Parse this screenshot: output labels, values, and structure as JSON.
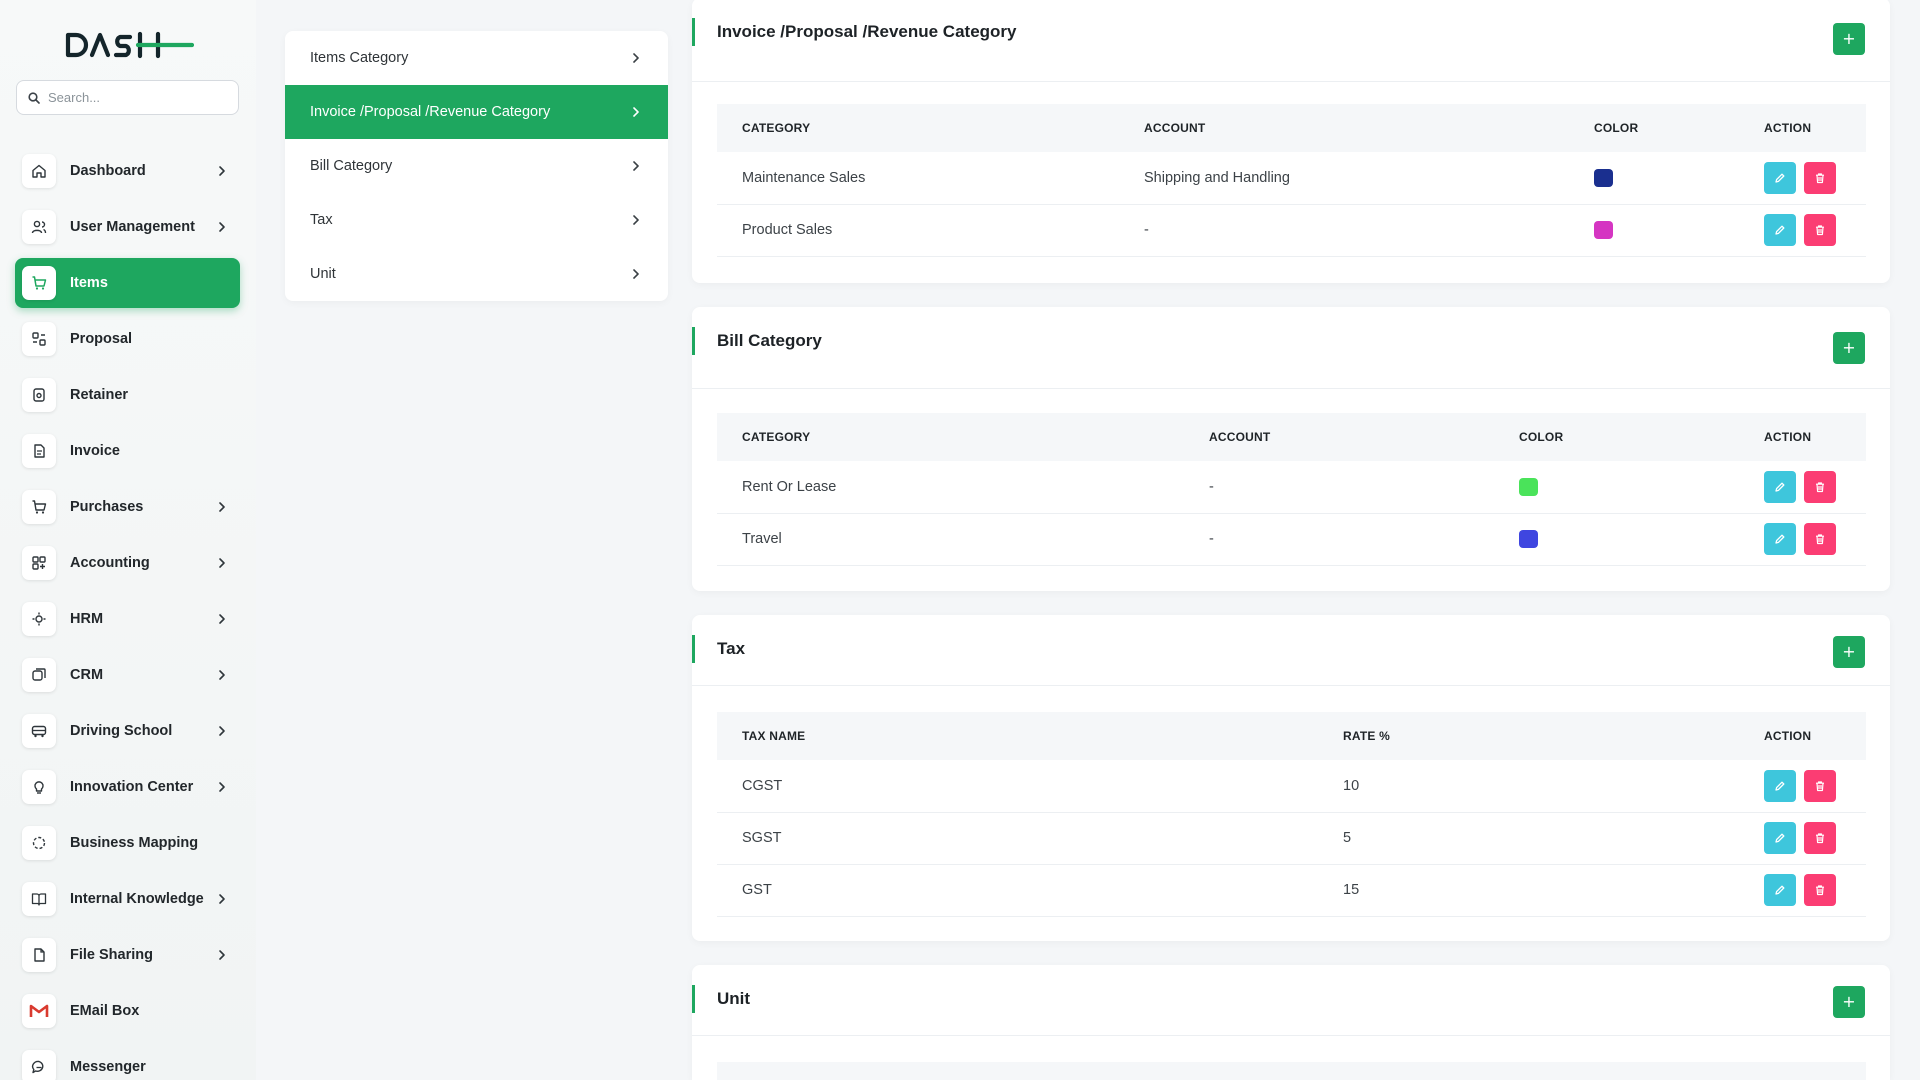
{
  "app": {
    "logo_text": "DASH"
  },
  "search": {
    "placeholder": "Search..."
  },
  "sidebar": {
    "items": [
      {
        "label": "Dashboard",
        "icon": "home-icon",
        "chevron": true,
        "active": false
      },
      {
        "label": "User Management",
        "icon": "users-icon",
        "chevron": true,
        "active": false
      },
      {
        "label": "Items",
        "icon": "cart-icon",
        "chevron": false,
        "active": true
      },
      {
        "label": "Proposal",
        "icon": "proposal-icon",
        "chevron": false,
        "active": false
      },
      {
        "label": "Retainer",
        "icon": "retainer-icon",
        "chevron": false,
        "active": false
      },
      {
        "label": "Invoice",
        "icon": "invoice-icon",
        "chevron": false,
        "active": false
      },
      {
        "label": "Purchases",
        "icon": "cart-icon",
        "chevron": true,
        "active": false
      },
      {
        "label": "Accounting",
        "icon": "grid-icon",
        "chevron": true,
        "active": false
      },
      {
        "label": "HRM",
        "icon": "hrm-icon",
        "chevron": true,
        "active": false
      },
      {
        "label": "CRM",
        "icon": "crm-icon",
        "chevron": true,
        "active": false
      },
      {
        "label": "Driving School",
        "icon": "bus-icon",
        "chevron": true,
        "active": false
      },
      {
        "label": "Innovation Center",
        "icon": "bulb-icon",
        "chevron": true,
        "active": false
      },
      {
        "label": "Business Mapping",
        "icon": "circle-dashed-icon",
        "chevron": false,
        "active": false
      },
      {
        "label": "Internal Knowledge",
        "icon": "book-icon",
        "chevron": true,
        "active": false
      },
      {
        "label": "File Sharing",
        "icon": "file-icon",
        "chevron": true,
        "active": false
      },
      {
        "label": "EMail Box",
        "icon": "gmail-icon",
        "chevron": false,
        "active": false
      },
      {
        "label": "Messenger",
        "icon": "chat-icon",
        "chevron": false,
        "active": false
      }
    ]
  },
  "settings_menu": {
    "items": [
      {
        "label": "Items Category",
        "active": false
      },
      {
        "label": "Invoice /Proposal /Revenue Category",
        "active": true
      },
      {
        "label": "Bill Category",
        "active": false
      },
      {
        "label": "Tax",
        "active": false
      },
      {
        "label": "Unit",
        "active": false
      }
    ]
  },
  "invoice_category": {
    "title": "Invoice /Proposal /Revenue Category",
    "add_label": "+",
    "columns": [
      "CATEGORY",
      "ACCOUNT",
      "COLOR",
      "ACTION"
    ],
    "rows": [
      {
        "category": "Maintenance Sales",
        "account": "Shipping and Handling",
        "color": "#1a2f8f"
      },
      {
        "category": "Product Sales",
        "account": "-",
        "color": "#d535c2"
      }
    ]
  },
  "bill_category": {
    "title": "Bill Category",
    "add_label": "+",
    "columns": [
      "CATEGORY",
      "ACCOUNT",
      "COLOR",
      "ACTION"
    ],
    "rows": [
      {
        "category": "Rent Or Lease",
        "account": "-",
        "color": "#4ae35a"
      },
      {
        "category": "Travel",
        "account": "-",
        "color": "#3f46e0"
      }
    ]
  },
  "tax": {
    "title": "Tax",
    "add_label": "+",
    "columns": [
      "TAX NAME",
      "RATE %",
      "ACTION"
    ],
    "rows": [
      {
        "name": "CGST",
        "rate": "10"
      },
      {
        "name": "SGST",
        "rate": "5"
      },
      {
        "name": "GST",
        "rate": "15"
      }
    ]
  },
  "unit": {
    "title": "Unit",
    "add_label": "+"
  },
  "colors": {
    "accent": "#1ea75f",
    "edit": "#3ec6dc",
    "delete": "#fb3d73"
  }
}
